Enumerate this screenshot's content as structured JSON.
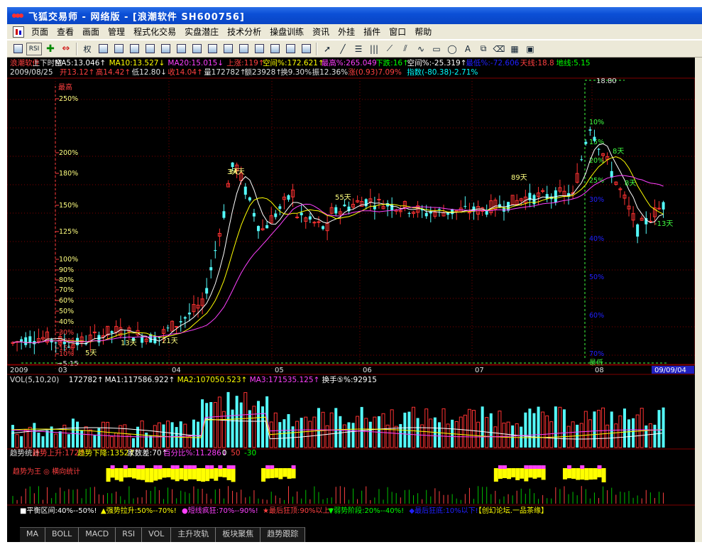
{
  "app": {
    "title": "飞狐交易师 - 网络版 - [浪潮软件 SH600756]"
  },
  "menu": [
    "页面",
    "查看",
    "画面",
    "管理",
    "程式化交易",
    "实盘潜庄",
    "技术分析",
    "操盘训练",
    "资讯",
    "外挂",
    "插件",
    "窗口",
    "帮助"
  ],
  "toolbar": {
    "rsi_label": "RSI",
    "quan_label": "权"
  },
  "header1": [
    {
      "text": "浪潮软件",
      "color": "#ff4040"
    },
    {
      "text": "上下时空",
      "color": "#e0e0e0"
    },
    {
      "text": "MA5:13.046↑",
      "color": "#ffffff"
    },
    {
      "text": "MA10:13.527↓",
      "color": "#ffff00"
    },
    {
      "text": "MA20:15.015↓",
      "color": "#ff40ff"
    },
    {
      "text": "上涨:119↑",
      "color": "#ff4040"
    },
    {
      "text": "空间%:172.621↑",
      "color": "#ffff00"
    },
    {
      "text": "最高%:265.049",
      "color": "#ff40ff"
    },
    {
      "text": "下跌:16↑",
      "color": "#00ff00"
    },
    {
      "text": "空间%:-25.319↑",
      "color": "#ffffff"
    },
    {
      "text": "最低%:-72.606",
      "color": "#2020ff"
    },
    {
      "text": "天线:18.8",
      "color": "#ff4040"
    },
    {
      "text": "地线:5.15",
      "color": "#00ff00"
    }
  ],
  "header2": [
    {
      "text": "2009/08/25",
      "color": "#e0e0e0"
    },
    {
      "text": "开13.12↑",
      "color": "#ff4040"
    },
    {
      "text": "高14.42↑",
      "color": "#ff4040"
    },
    {
      "text": "低12.80↓",
      "color": "#e0e0e0"
    },
    {
      "text": "收14.04↑",
      "color": "#ff4040"
    },
    {
      "text": "量172782↑",
      "color": "#e0e0e0"
    },
    {
      "text": "额23928↑",
      "color": "#e0e0e0"
    },
    {
      "text": "换9.30%",
      "color": "#e0e0e0"
    },
    {
      "text": "振12.36%",
      "color": "#e0e0e0"
    },
    {
      "text": "涨(0.93)7.09%",
      "color": "#ff4040"
    },
    {
      "text": "指数(-80.38)-2.71%",
      "color": "#00ffff"
    }
  ],
  "price_chart": {
    "high_label": "最高",
    "low_label": "最低",
    "top_price": "18.80",
    "bottom_price": "5.15",
    "left_pct": [
      "250%",
      "200%",
      "180%",
      "150%",
      "125%",
      "100%",
      "90%",
      "80%",
      "70%",
      "60%",
      "50%",
      "40%",
      "30%",
      "20%",
      "15%",
      "10%"
    ],
    "right_pct": [
      "10%",
      "15%",
      "20%",
      "25%",
      "30%",
      "40%",
      "50%",
      "60%",
      "70%"
    ],
    "day_labels": [
      "5天",
      "3天",
      "13天",
      "21天",
      "34天",
      "55天",
      "89天",
      "8天",
      "-13天",
      "8天"
    ],
    "months": [
      "2009",
      "03",
      "04",
      "05",
      "06",
      "07",
      "08"
    ],
    "date_end": "09/09/04"
  },
  "vol_header": [
    {
      "text": "VOL(5,10,20)",
      "color": "#e0e0e0"
    },
    {
      "text": "172782↑",
      "color": "#ffffff"
    },
    {
      "text": "MA1:117586.922↑",
      "color": "#ffffff"
    },
    {
      "text": "MA2:107050.523↑",
      "color": "#ffff00"
    },
    {
      "text": "MA3:171535.125↑",
      "color": "#ff40ff"
    },
    {
      "text": "换手⑤%:92915",
      "color": "#ffffff"
    }
  ],
  "trend_header": [
    {
      "text": "趋势统计",
      "color": "#e0e0e0"
    },
    {
      "text": "趋势上升:172↑",
      "color": "#ff4040"
    },
    {
      "text": "趋势下降:1352↑",
      "color": "#ffff00"
    },
    {
      "text": "家数差:70↑",
      "color": "#ffffff"
    },
    {
      "text": "百分比%:11.286↓",
      "color": "#ff40ff"
    },
    {
      "text": "0",
      "color": "#ffffff"
    },
    {
      "text": "50",
      "color": "#ff4040"
    },
    {
      "text": "-30",
      "color": "#00ff00"
    }
  ],
  "trend_title": "趋势为王 ◎ 横向统计",
  "legend": [
    {
      "text": "■平衡区间:40%--50%!",
      "color": "#ffffff"
    },
    {
      "text": "▲强势拉升:50%--70%!",
      "color": "#ffff00"
    },
    {
      "text": "●短线疯狂:70%--90%!",
      "color": "#ff40ff"
    },
    {
      "text": "★最后狂顶:90%以上!",
      "color": "#ff4040"
    },
    {
      "text": "▼弱势阶段:20%--40%!",
      "color": "#00ff00"
    },
    {
      "text": "◆最后狂底:10%以下!",
      "color": "#2020ff"
    },
    {
      "text": "【创幻论坛.一品茶缘】",
      "color": "#ffff00"
    }
  ],
  "tabs": [
    "MA",
    "BOLL",
    "MACD",
    "RSI",
    "VOL",
    "主升攻轨",
    "板块聚焦",
    "趋势跟踪"
  ],
  "colors": {
    "up": "#ff3232",
    "down": "#54fcfc",
    "bg": "#000000",
    "grid": "#800000"
  }
}
